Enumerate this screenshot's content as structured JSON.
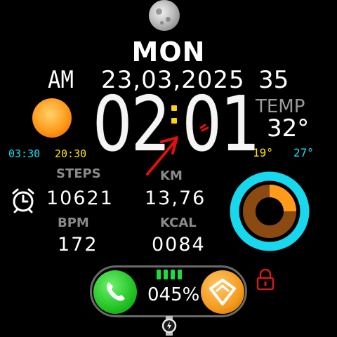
{
  "header": {
    "day": "MON",
    "ampm": "AM",
    "date": "23,03,2025",
    "seconds": "35"
  },
  "time": {
    "hours": "02",
    "minutes": "01"
  },
  "weather": {
    "temp_label": "TEMP",
    "temp_value": "32°",
    "temp_min": "19°",
    "temp_max": "27°",
    "sunrise": "03:30",
    "sunset": "20:30"
  },
  "stats": {
    "steps_label": "STEPS",
    "steps_value": "10621",
    "km_label": "KM",
    "km_value": "13,76",
    "bpm_label": "BPM",
    "bpm_value": "172",
    "kcal_label": "KCAL",
    "kcal_value": "0084"
  },
  "progress_ring": {
    "fraction": 0.25,
    "outer_color": "#18d8ee",
    "inner_color": "#8b4a12",
    "fill_color": "#ff9a1a"
  },
  "bottom": {
    "battery": "045%",
    "battery_segments": 4
  },
  "colors": {
    "cyan": "#18e0f0",
    "yellow": "#ffe600",
    "battery_green": "#1fdc3a",
    "lock_red": "#d01c1c"
  },
  "icons": [
    "moon-icon",
    "sun-icon",
    "alarm-icon",
    "phone-icon",
    "app-icon",
    "lock-icon",
    "charge-icon"
  ]
}
